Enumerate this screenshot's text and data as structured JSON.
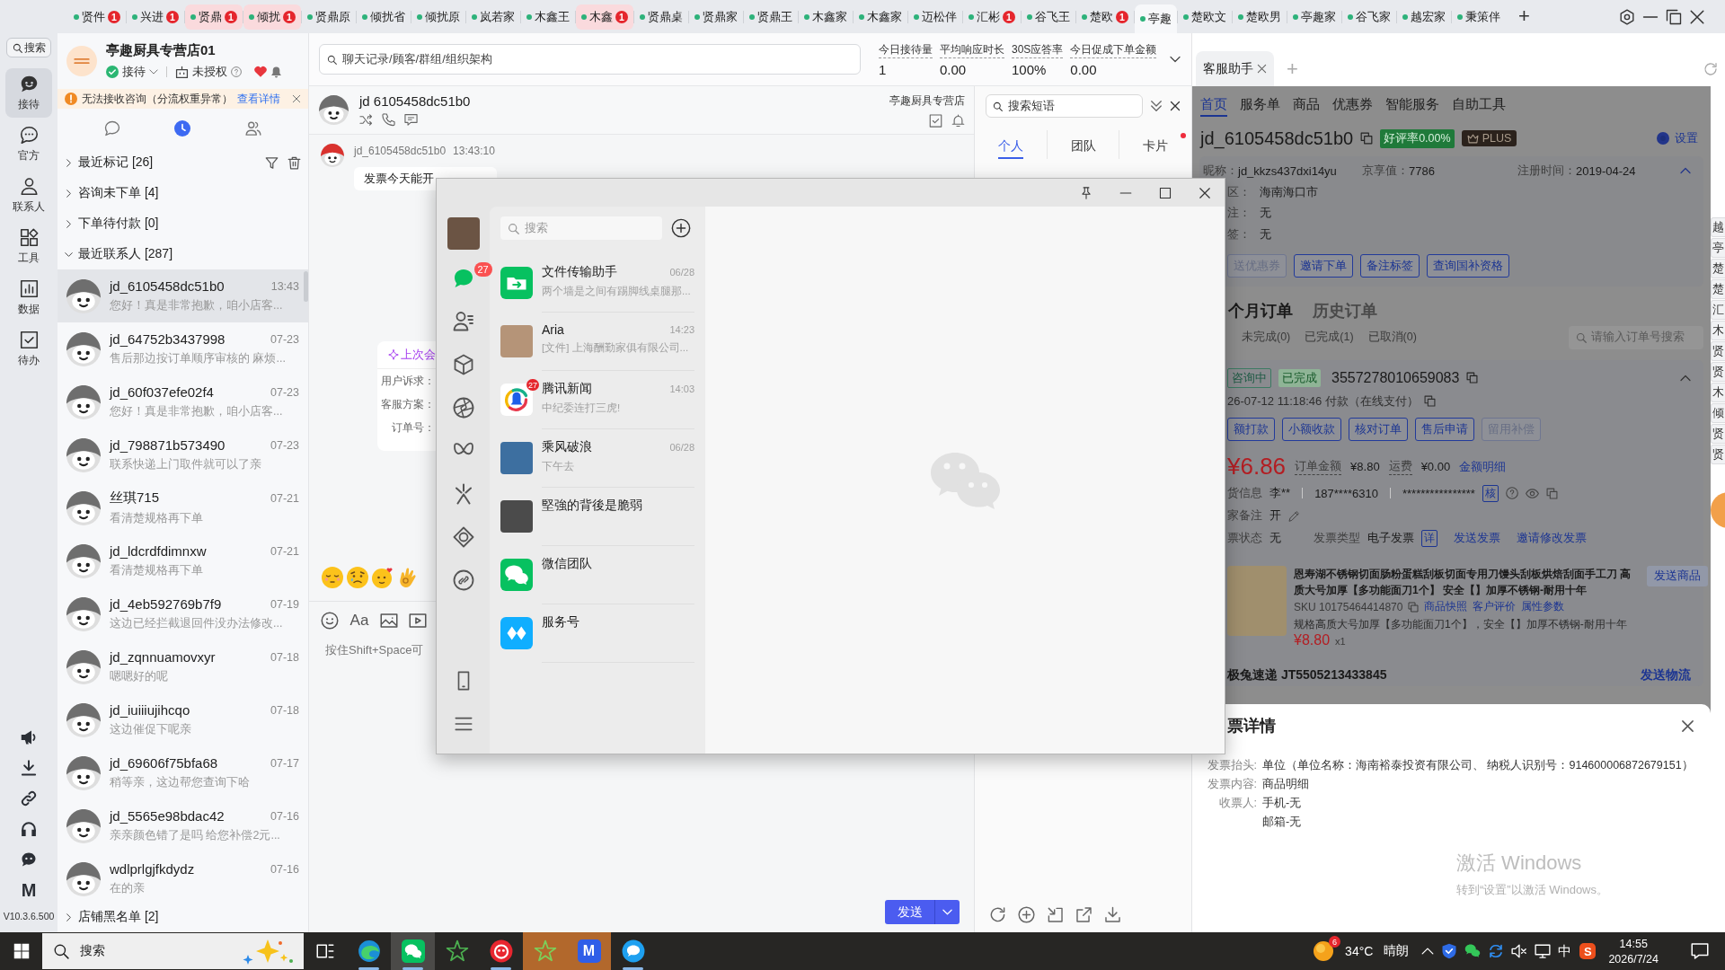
{
  "title_bar": {
    "tabs": [
      {
        "label": "贤件",
        "badge": "1",
        "highlighted": false,
        "selected": false
      },
      {
        "label": "兴进",
        "badge": "1",
        "highlighted": false,
        "selected": false
      },
      {
        "label": "贤鼎",
        "badge": "1",
        "highlighted": true,
        "selected": false
      },
      {
        "label": "倾扰",
        "badge": "1",
        "highlighted": true,
        "selected": false
      },
      {
        "label": "贤鼎原",
        "highlighted": false,
        "selected": false
      },
      {
        "label": "倾扰省",
        "highlighted": false,
        "selected": false
      },
      {
        "label": "倾扰原",
        "highlighted": false,
        "selected": false
      },
      {
        "label": "岚若家",
        "highlighted": false,
        "selected": false
      },
      {
        "label": "木鑫王",
        "highlighted": false,
        "selected": false
      },
      {
        "label": "木鑫",
        "badge": "1",
        "highlighted": true,
        "selected": false
      },
      {
        "label": "贤鼎桌",
        "highlighted": false,
        "selected": false
      },
      {
        "label": "贤鼎家",
        "highlighted": false,
        "selected": false
      },
      {
        "label": "贤鼎王",
        "highlighted": false,
        "selected": false
      },
      {
        "label": "木鑫家",
        "highlighted": false,
        "selected": false
      },
      {
        "label": "木鑫家",
        "highlighted": false,
        "selected": false
      },
      {
        "label": "迈松伴",
        "highlighted": false,
        "selected": false
      },
      {
        "label": "汇彬",
        "badge": "1",
        "highlighted": false,
        "selected": false
      },
      {
        "label": "谷飞王",
        "highlighted": false,
        "selected": false
      },
      {
        "label": "楚欧",
        "badge": "1",
        "highlighted": false,
        "selected": false
      },
      {
        "label": "亭趣",
        "highlighted": false,
        "selected": true
      },
      {
        "label": "楚欧文",
        "highlighted": false,
        "selected": false
      },
      {
        "label": "楚欧男",
        "highlighted": false,
        "selected": false
      },
      {
        "label": "亭趣家",
        "highlighted": false,
        "selected": false
      },
      {
        "label": "谷飞家",
        "highlighted": false,
        "selected": false
      },
      {
        "label": "越宏家",
        "highlighted": false,
        "selected": false
      },
      {
        "label": "秉策伴",
        "highlighted": false,
        "selected": false
      }
    ],
    "add": "+"
  },
  "sidebar": {
    "search": "搜索",
    "items": [
      {
        "label": "接待",
        "selected": true
      },
      {
        "label": "官方",
        "selected": false
      },
      {
        "label": "联系人",
        "selected": false
      },
      {
        "label": "工具",
        "selected": false
      },
      {
        "label": "数据",
        "selected": false
      },
      {
        "label": "待办",
        "selected": false
      }
    ],
    "logo": "M",
    "version": "V10.3.6.500"
  },
  "store": {
    "name": "亭趣厨具专营店01",
    "status": "接待",
    "auth": "未授权"
  },
  "notice": {
    "text": "无法接收咨询（分流权重异常）",
    "link": "查看详情"
  },
  "list_tabs": [
    {
      "selected": false
    },
    {
      "selected": true
    },
    {
      "selected": false
    }
  ],
  "groups": [
    {
      "label": "最近标记 [26]",
      "expanded": false
    },
    {
      "label": "咨询未下单 [4]",
      "expanded": false
    },
    {
      "label": "下单待付款 [0]",
      "expanded": false
    },
    {
      "label": "最近联系人 [287]",
      "expanded": true,
      "contacts": [
        {
          "name": "jd_6105458dc51b0",
          "time": "13:43",
          "preview": "您好！真是非常抱歉，咱小店客...",
          "selected": true
        },
        {
          "name": "jd_64752b3437998",
          "time": "07-23",
          "preview": "售后那边按订单顺序审核的 麻烦...",
          "selected": false
        },
        {
          "name": "jd_60f037efe02f4",
          "time": "07-23",
          "preview": "您好！真是非常抱歉，咱小店客...",
          "selected": false
        },
        {
          "name": "jd_798871b573490",
          "time": "07-23",
          "preview": "联系快递上门取件就可以了亲",
          "selected": false
        },
        {
          "name": "丝琪715",
          "time": "07-21",
          "preview": "看清楚规格再下单",
          "selected": false
        },
        {
          "name": "jd_ldcrdfdimnxw",
          "time": "07-21",
          "preview": "看清楚规格再下单",
          "selected": false
        },
        {
          "name": "jd_4eb592769b7f9",
          "time": "07-19",
          "preview": "这边已经拦截退回件没办法修改...",
          "selected": false
        },
        {
          "name": "jd_zqnnuamovxyr",
          "time": "07-18",
          "preview": "嗯嗯好的呢",
          "selected": false
        },
        {
          "name": "jd_iuiiiujihcqo",
          "time": "07-18",
          "preview": "这边催促下呢亲",
          "selected": false
        },
        {
          "name": "jd_69606f75bfa68",
          "time": "07-17",
          "preview": "稍等亲，这边帮您查询下哈",
          "selected": false
        },
        {
          "name": "jd_5565e98bdac42",
          "time": "07-16",
          "preview": "亲亲颜色错了是吗 给您补偿2元...",
          "selected": false
        },
        {
          "name": "wdlprlgjfkdydz",
          "time": "07-16",
          "preview": "在的亲",
          "selected": false
        }
      ]
    },
    {
      "label": "店铺黑名单 [2]",
      "expanded": false
    }
  ],
  "conversation": {
    "search": {
      "placeholder": "聊天记录/顾客/群组/组织架构"
    },
    "stats": [
      {
        "label": "今日接待量",
        "value": "1"
      },
      {
        "label": "平均响应时长",
        "value": "0.00"
      },
      {
        "label": "30S应答率",
        "value": "100%"
      },
      {
        "label": "今日促成下单金额",
        "value": "0.00"
      }
    ],
    "customer": "jd 6105458dc51b0",
    "store": "亭趣厨具专营店",
    "messages": [
      {
        "sender": "jd_6105458dc51b0",
        "time": "13:43:10",
        "text": "发票今天能开"
      }
    ],
    "summary": {
      "title": "上次会",
      "fields": [
        "用户诉求：",
        "客服方案：",
        "订单号："
      ]
    },
    "composer": {
      "font_button": "Aa",
      "placeholder": "按住Shift+Space可"
    },
    "send": "发送"
  },
  "phrases": {
    "search": {
      "placeholder": "搜索短语"
    },
    "tabs": [
      {
        "label": "个人",
        "selected": true,
        "unread": false
      },
      {
        "label": "团队",
        "selected": false,
        "unread": false
      },
      {
        "label": "卡片",
        "selected": false,
        "unread": true
      }
    ]
  },
  "assistant": {
    "tabs": [
      {
        "label": "客服助手",
        "selected": true
      }
    ],
    "add": "+",
    "nav": [
      {
        "label": "首页",
        "selected": true
      },
      {
        "label": "服务单",
        "selected": false
      },
      {
        "label": "商品",
        "selected": false
      },
      {
        "label": "优惠券",
        "selected": false
      },
      {
        "label": "智能服务",
        "selected": false
      },
      {
        "label": "自助工具",
        "selected": false
      }
    ],
    "customer": {
      "id": "jd_6105458dc51b0",
      "rating": "好评率0.00%",
      "membership": "PLUS",
      "settings": "设置"
    },
    "profile": [
      {
        "label": "昵称：",
        "value": "jd_kkzs437dxi14yu"
      },
      {
        "label": "京享值：",
        "value": "7786"
      },
      {
        "label": "注册时间：",
        "value": "2019-04-24"
      }
    ],
    "details": [
      {
        "label": "区：",
        "value": "海南海口市"
      },
      {
        "label": "注：",
        "value": "无"
      },
      {
        "label": "签：",
        "value": "无"
      }
    ],
    "actions": [
      {
        "label": "送优惠券",
        "disabled": true
      },
      {
        "label": "邀请下单",
        "disabled": false
      },
      {
        "label": "备注标签",
        "disabled": false
      },
      {
        "label": "查询国补资格",
        "disabled": false
      }
    ],
    "order_tabs": [
      {
        "label": "个月订单",
        "selected": true
      },
      {
        "label": "历史订单",
        "selected": false
      }
    ],
    "order_filters": [
      "未完成(0)",
      "已完成(1)",
      "已取消(0)"
    ],
    "order_search": {
      "placeholder": "请输入订单号搜索"
    },
    "order": {
      "tags": [
        {
          "label": "咨询中",
          "kind": "outline"
        },
        {
          "label": "已完成",
          "kind": "success"
        }
      ],
      "number": "3557278010659083",
      "paid_at": "26-07-12 11:18:46 付款（在线支付）",
      "actions": [
        {
          "label": "额打款",
          "disabled": false
        },
        {
          "label": "小额收款",
          "disabled": false
        },
        {
          "label": "核对订单",
          "disabled": false
        },
        {
          "label": "售后申请",
          "disabled": false
        },
        {
          "label": "留用补偿",
          "disabled": true
        }
      ],
      "paid": "¥6.86",
      "amounts": [
        {
          "label": "订单金额",
          "value": "¥8.80"
        },
        {
          "label": "运费",
          "value": "¥0.00"
        }
      ],
      "amount_detail": "金额明细",
      "receiver": {
        "label": "货信息",
        "name": "李**",
        "phone": "187****6310",
        "address": "****************",
        "verify": "核"
      },
      "remark": {
        "label": "家备注",
        "value": "开"
      },
      "invoice": {
        "label": "票状态",
        "value": "无",
        "type_label": "发票类型",
        "type": "电子发票",
        "detail": "详",
        "links": [
          "发送发票",
          "邀请修改发票"
        ]
      },
      "product": {
        "title": "恩寿湖不锈钢切面肠粉蛋糕刮板切面专用刀馒头刮板烘焙刮面手工刀 高质大号加厚【多功能面刀1个】 安全【】加厚不锈钢-耐用十年",
        "sku": "SKU 10175464414870",
        "links": [
          "商品快照",
          "客户评价",
          "属性参数"
        ],
        "spec": "规格高质大号加厚【多功能面刀1个】，安全【】加厚不锈钢-耐用十年",
        "price": "¥8.80",
        "quantity": "x1",
        "send": "发送商品"
      },
      "logistics": {
        "text": "极兔速递 JT5505213433845",
        "send": "发送物流"
      }
    },
    "invoice_drawer": {
      "title": "票详情",
      "rows": [
        {
          "label": "发票抬头:",
          "values": [
            "单位（单位名称：海南裕泰投资有限公司、 纳税人识别号：914600006872679151）"
          ]
        },
        {
          "label": "发票内容:",
          "values": [
            "商品明细"
          ]
        },
        {
          "label": "收票人:",
          "values": [
            "手机-无",
            "邮箱-无"
          ]
        }
      ]
    },
    "side_tabs": [
      "越",
      "亭",
      "楚",
      "楚",
      "汇",
      "木",
      "贤",
      "贤",
      "木",
      "倾",
      "贤",
      "贤"
    ]
  },
  "windows_notice": {
    "title": "激活 Windows",
    "text": "转到“设置”以激活 Windows。"
  },
  "wechat": {
    "nav": [
      {
        "selected": true,
        "badge": "27"
      },
      {
        "selected": false
      },
      {
        "selected": false
      },
      {
        "selected": false
      },
      {
        "selected": false
      },
      {
        "selected": false
      },
      {
        "selected": false
      },
      {
        "selected": false
      }
    ],
    "search": {
      "placeholder": "搜索"
    },
    "chats": [
      {
        "kind": "app",
        "name": "文件传输助手",
        "time": "06/28",
        "preview": "两个墙是之间有踢脚线桌腿那..."
      },
      {
        "kind": "photo",
        "name": "Aria",
        "time": "14:23",
        "preview": "[文件] 上海酬勤家俱有限公司..."
      },
      {
        "kind": "app",
        "name": "腾讯新闻",
        "time": "14:03",
        "preview": "中纪委连打三虎!",
        "badge": "27"
      },
      {
        "kind": "photo",
        "name": "乘风破浪",
        "time": "06/28",
        "preview": "下午去"
      },
      {
        "kind": "photo",
        "name": "堅強的背後是脆弱"
      },
      {
        "kind": "app",
        "name": "微信团队"
      },
      {
        "kind": "app",
        "name": "服务号"
      }
    ]
  },
  "taskbar": {
    "search": {
      "placeholder": "搜索"
    },
    "apps": [
      {
        "open": true,
        "focused": false,
        "flashing": false
      },
      {
        "open": true,
        "focused": true,
        "flashing": false
      },
      {
        "open": false,
        "focused": false,
        "flashing": false
      },
      {
        "open": true,
        "focused": false,
        "flashing": false
      },
      {
        "open": false,
        "focused": false,
        "flashing": true
      },
      {
        "open": false,
        "focused": false,
        "flashing": true,
        "letter": "M"
      },
      {
        "open": true,
        "focused": false,
        "flashing": false
      }
    ],
    "weather": {
      "badge": "6",
      "temperature": "34°C",
      "condition": "晴朗"
    },
    "input_method": "中",
    "ime_logo": "S",
    "time": "14:55",
    "date": "2026/7/24"
  }
}
